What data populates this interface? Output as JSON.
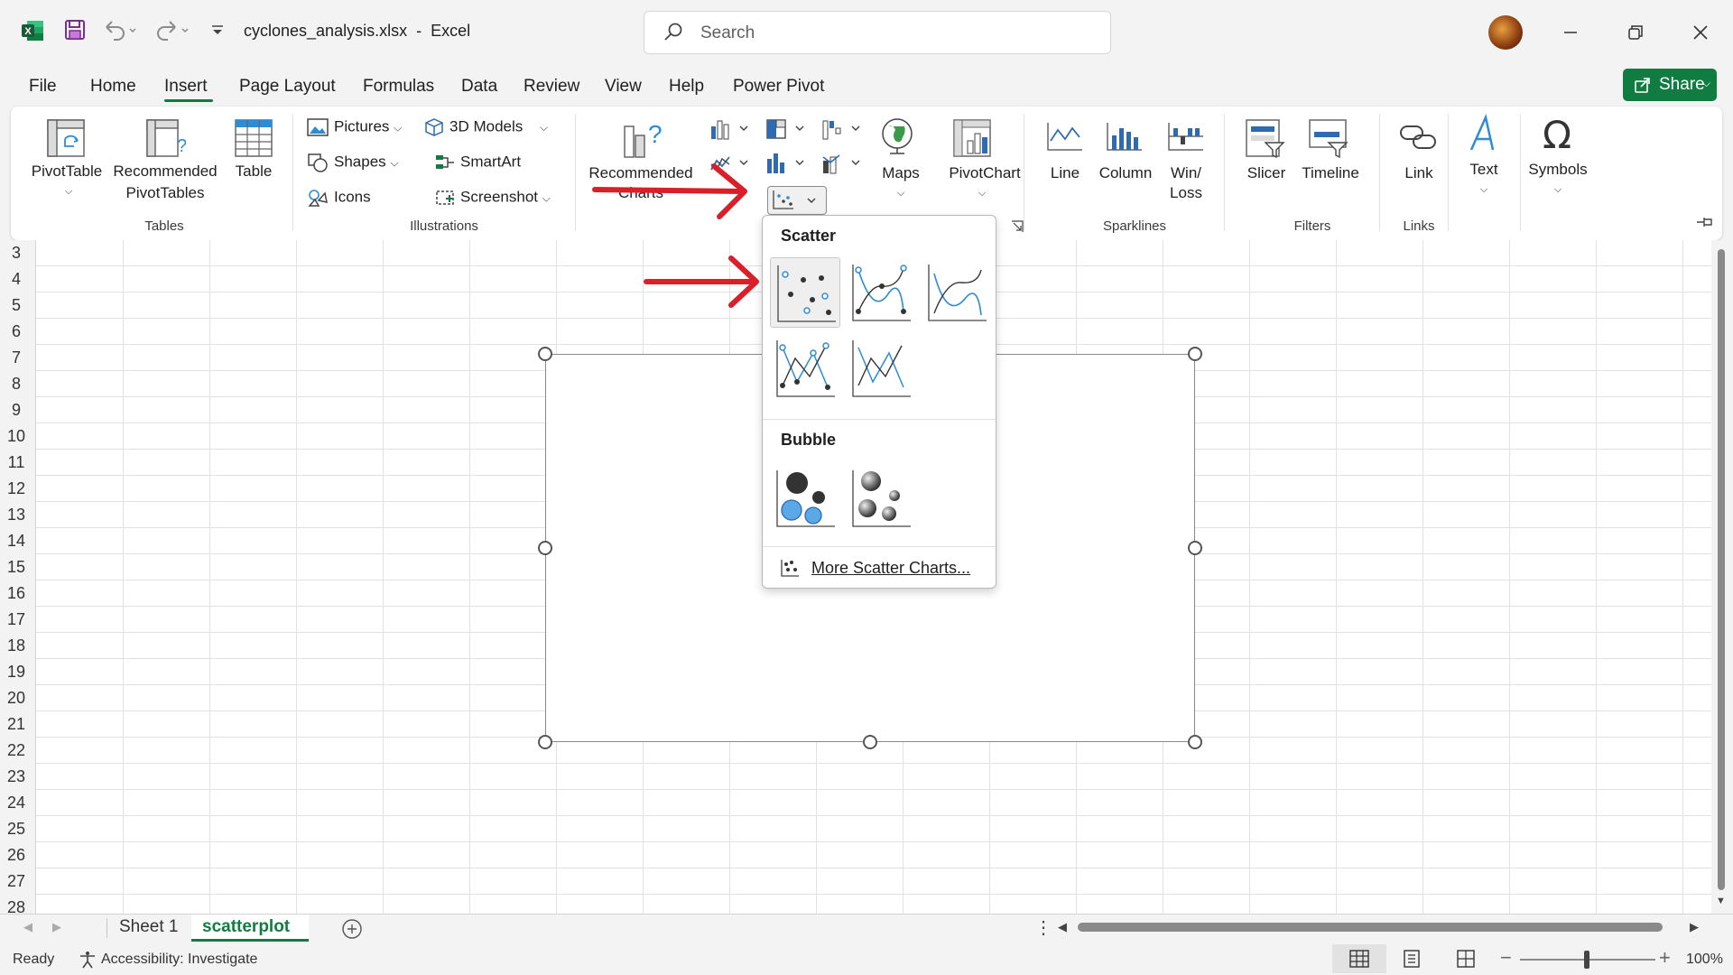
{
  "title_bar": {
    "file_title": "cyclones_analysis.xlsx  -  Excel",
    "search_placeholder": "Search"
  },
  "menu_tabs": [
    {
      "label": "File"
    },
    {
      "label": "Home"
    },
    {
      "label": "Insert",
      "active": true
    },
    {
      "label": "Page Layout"
    },
    {
      "label": "Formulas"
    },
    {
      "label": "Data"
    },
    {
      "label": "Review"
    },
    {
      "label": "View"
    },
    {
      "label": "Help"
    },
    {
      "label": "Power Pivot"
    }
  ],
  "share_label": "Share",
  "ribbon": {
    "tables": {
      "group_label": "Tables",
      "pivot_table": "PivotTable",
      "recommended_pivot_1": "Recommended",
      "recommended_pivot_2": "PivotTables",
      "table": "Table"
    },
    "illustrations": {
      "group_label": "Illustrations",
      "pictures": "Pictures",
      "shapes": "Shapes",
      "icons": "Icons",
      "models_3d": "3D Models",
      "smartart": "SmartArt",
      "screenshot": "Screenshot"
    },
    "charts": {
      "recommended_1": "Recommended",
      "recommended_2": "Charts",
      "maps": "Maps",
      "pivot_chart": "PivotChart"
    },
    "sparklines": {
      "group_label": "Sparklines",
      "line": "Line",
      "column": "Column",
      "winloss_1": "Win/",
      "winloss_2": "Loss"
    },
    "filters": {
      "group_label": "Filters",
      "slicer": "Slicer",
      "timeline": "Timeline"
    },
    "links": {
      "group_label": "Links",
      "link": "Link"
    },
    "text": {
      "label": "Text"
    },
    "symbols": {
      "label": "Symbols"
    }
  },
  "row_numbers": [
    "3",
    "4",
    "5",
    "6",
    "7",
    "8",
    "9",
    "10",
    "11",
    "12",
    "13",
    "14",
    "15",
    "16",
    "17",
    "18",
    "19",
    "20",
    "21",
    "22",
    "23",
    "24",
    "25",
    "26",
    "27",
    "28"
  ],
  "scatter_dropdown": {
    "scatter_heading": "Scatter",
    "bubble_heading": "Bubble",
    "more_link": "More Scatter Charts...",
    "scatter_items": [
      "scatter-markers",
      "scatter-smooth-lines-markers",
      "scatter-smooth-lines",
      "scatter-straight-lines-markers",
      "scatter-straight-lines"
    ],
    "bubble_items": [
      "bubble",
      "bubble-3d"
    ]
  },
  "sheets": [
    {
      "label": "Sheet 1"
    },
    {
      "label": "scatterplot",
      "active": true
    }
  ],
  "status": {
    "ready": "Ready",
    "accessibility": "Accessibility: Investigate",
    "zoom": "100%"
  },
  "colors": {
    "excel_green": "#107c41",
    "annotation_red": "#d9202a",
    "chart_blue": "#2e8bd6"
  }
}
